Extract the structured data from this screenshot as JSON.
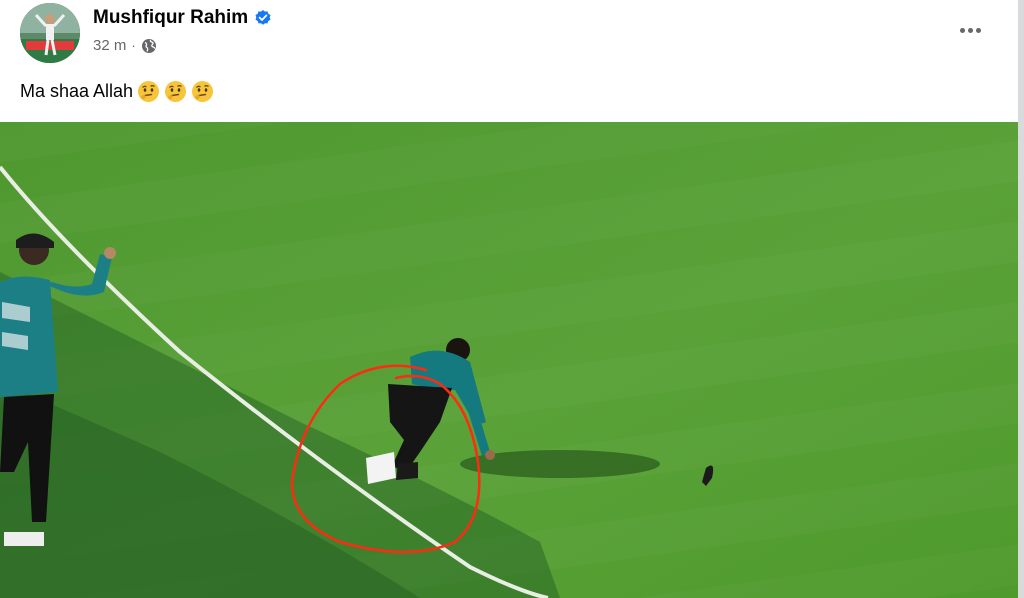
{
  "post": {
    "author_name": "Mushfiqur Rahim",
    "timestamp": "32 m",
    "meta_separator": "·",
    "audience_icon": "globe-icon",
    "verified_icon": "verified-badge-icon",
    "more_icon": "more-options-icon",
    "text": "Ma shaa Allah",
    "emojis": [
      "thinking-face-emoji",
      "thinking-face-emoji",
      "thinking-face-emoji"
    ]
  },
  "colors": {
    "verified_blue": "#1877f2",
    "pitch_green": "#4f9a2a",
    "annotation_red": "#ff2a12"
  }
}
